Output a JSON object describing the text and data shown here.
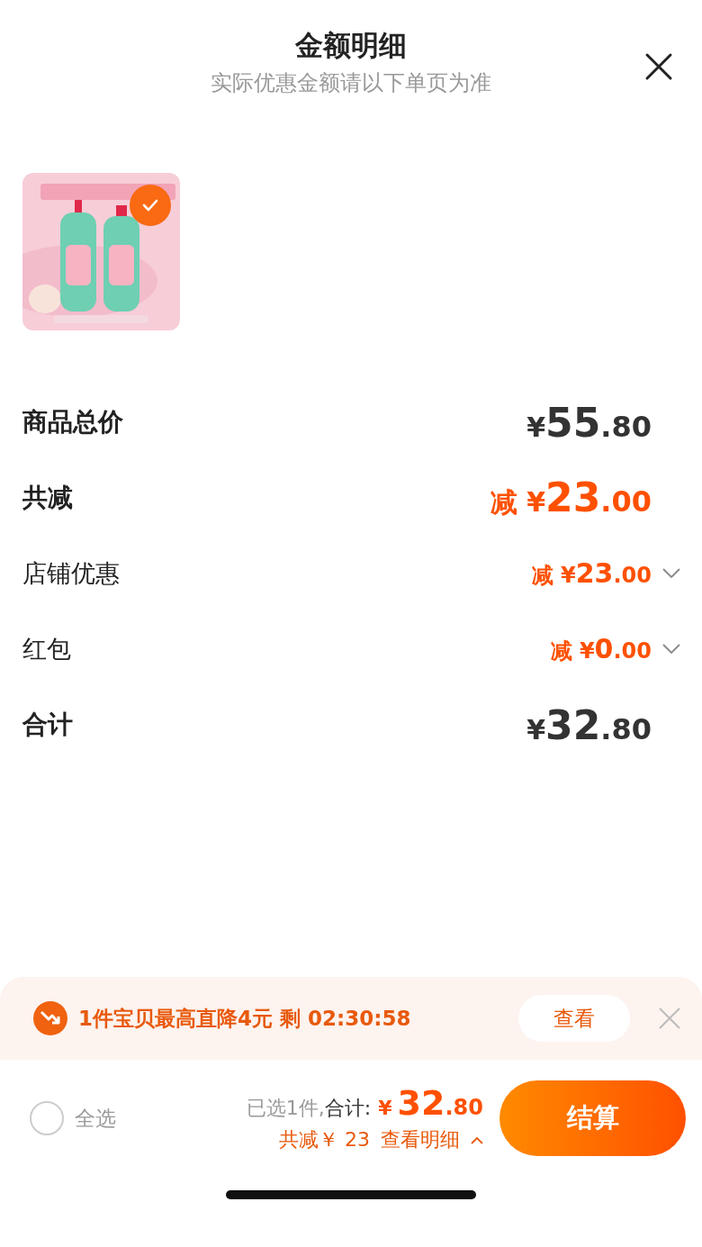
{
  "header": {
    "title": "金额明细",
    "subtitle": "实际优惠金额请以下单页为准"
  },
  "products": [
    {
      "kind": "picture",
      "checked": true
    }
  ],
  "rows": [
    {
      "label": "商品总价",
      "kind": "main",
      "color": "#333333",
      "prefix": "¥",
      "integer": "55",
      "decimal": ".80",
      "expandable": false
    },
    {
      "label": "共减",
      "kind": "main",
      "color": "#ff5000",
      "prefix": "减 ¥",
      "integer": "23",
      "decimal": ".00",
      "expandable": false
    },
    {
      "label": "店铺优惠",
      "kind": "sub",
      "color": "#ff5000",
      "prefix": "减 ¥",
      "integer": "23",
      "decimal": ".00",
      "expandable": true
    },
    {
      "label": "红包",
      "kind": "sub",
      "color": "#ff5000",
      "prefix": "减 ¥",
      "integer": "0",
      "decimal": ".00",
      "expandable": true
    },
    {
      "label": "合计",
      "kind": "main",
      "color": "#333333",
      "prefix": "¥",
      "integer": "32",
      "decimal": ".80",
      "expandable": false
    }
  ],
  "promo": {
    "text": "1件宝贝最高直降4元 剩 02:30:58",
    "button": "查看"
  },
  "footer": {
    "select_all": {
      "label": "全选",
      "checked": false
    },
    "selected_text": "已选1件,",
    "total_label": "合计:",
    "currency": "¥",
    "integer": "32",
    "decimal": ".80",
    "saving": "共减￥ 23",
    "details_link": "查看明细",
    "checkout": "结算"
  }
}
